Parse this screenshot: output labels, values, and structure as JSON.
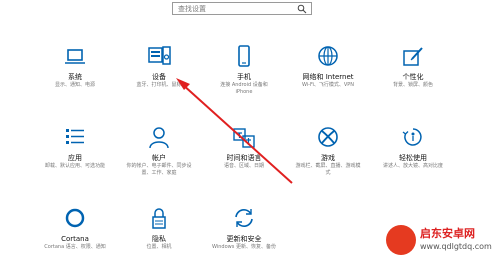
{
  "search": {
    "placeholder": "查找设置"
  },
  "tiles": [
    {
      "icon": "laptop-icon",
      "title": "系统",
      "desc": "显示、通知、电源"
    },
    {
      "icon": "keyboard-speaker-icon",
      "title": "设备",
      "desc": "蓝牙、打印机、鼠标"
    },
    {
      "icon": "phone-icon",
      "title": "手机",
      "desc": "连接 Android 设备和\niPhone"
    },
    {
      "icon": "globe-icon",
      "title": "网络和 Internet",
      "desc": "Wi-Fi、飞行模式、VPN"
    },
    {
      "icon": "pen-tablet-icon",
      "title": "个性化",
      "desc": "背景、锁屏、颜色"
    },
    {
      "icon": "apps-list-icon",
      "title": "应用",
      "desc": "卸载、默认应用、可选功能"
    },
    {
      "icon": "person-icon",
      "title": "帐户",
      "desc": "你的帐户、电子邮件、同步设\n置、工作、家庭"
    },
    {
      "icon": "time-language-icon",
      "title": "时间和语言",
      "desc": "语音、区域、日期"
    },
    {
      "icon": "xbox-icon",
      "title": "游戏",
      "desc": "游戏栏、截屏、直播、游戏模\n式"
    },
    {
      "icon": "accessibility-icon",
      "title": "轻松使用",
      "desc": "讲述人、放大镜、高对比度"
    },
    {
      "icon": "cortana-icon",
      "title": "Cortana",
      "desc": "Cortana 语言、权限、通知"
    },
    {
      "icon": "lock-icon",
      "title": "隐私",
      "desc": "位置、相机"
    },
    {
      "icon": "update-sync-icon",
      "title": "更新和安全",
      "desc": "Windows 更新、恢复、备份"
    }
  ],
  "watermark": {
    "title": "启东安卓网",
    "url": "www.qdlgtdq.com"
  }
}
